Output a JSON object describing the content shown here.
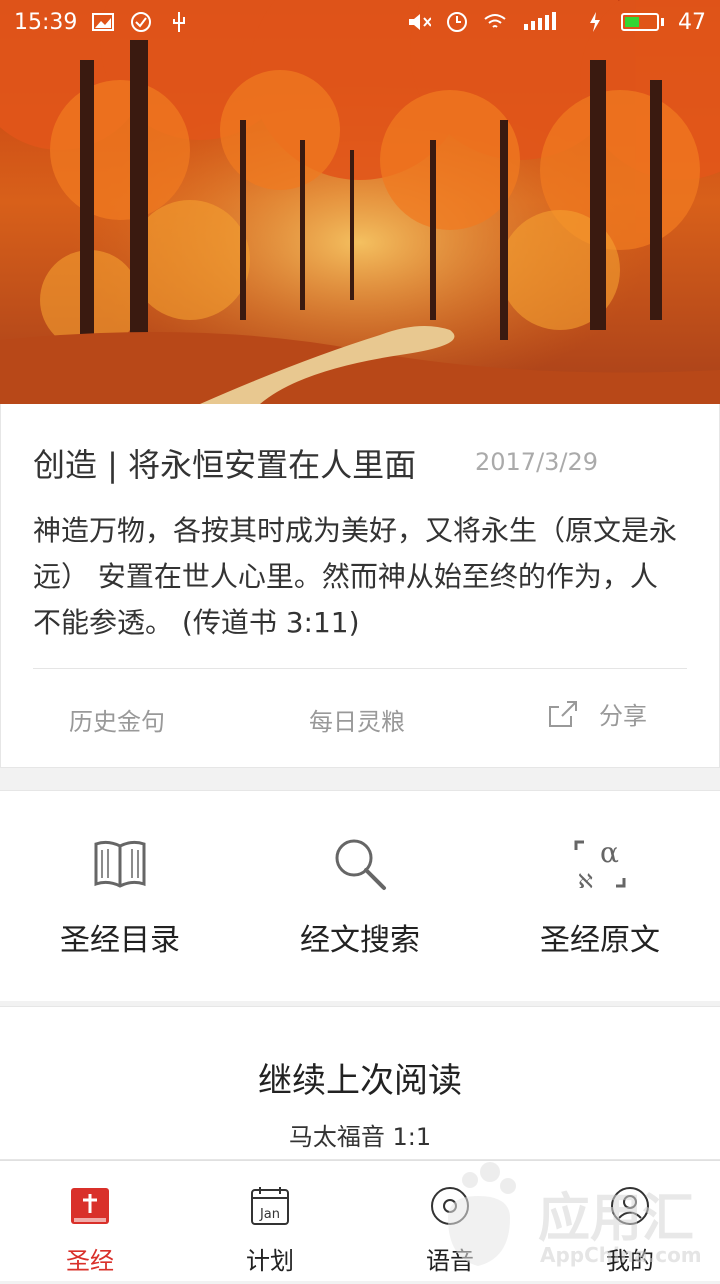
{
  "status_bar": {
    "time": "15:39",
    "battery": "47",
    "battery_level": 0.47
  },
  "daily": {
    "title": "创造 | 将永恒安置在人里面",
    "date": "2017/3/29",
    "body": "神造万物，各按其时成为美好，又将永生（原文是永远） 安置在世人心里。然而神从始至终的作为，人不能参透。 (传道书 3:11)",
    "actions": {
      "history": "历史金句",
      "daily_bread": "每日灵粮",
      "share": "分享"
    }
  },
  "tools": [
    {
      "label": "圣经目录",
      "icon": "book-icon"
    },
    {
      "label": "经文搜索",
      "icon": "search-icon"
    },
    {
      "label": "圣经原文",
      "icon": "original-text-icon"
    }
  ],
  "continue_reading": {
    "title": "继续上次阅读",
    "position": "马太福音 1:1"
  },
  "tabbar": {
    "items": [
      {
        "label": "圣经",
        "icon": "bible-icon",
        "active": true
      },
      {
        "label": "计划",
        "icon": "calendar-icon",
        "icon_text": "Jan"
      },
      {
        "label": "语音",
        "icon": "audio-icon"
      },
      {
        "label": "我的",
        "icon": "profile-icon"
      }
    ],
    "active_color": "#d9302a"
  },
  "watermark": {
    "name": "应用汇",
    "url": "AppChina.com"
  }
}
